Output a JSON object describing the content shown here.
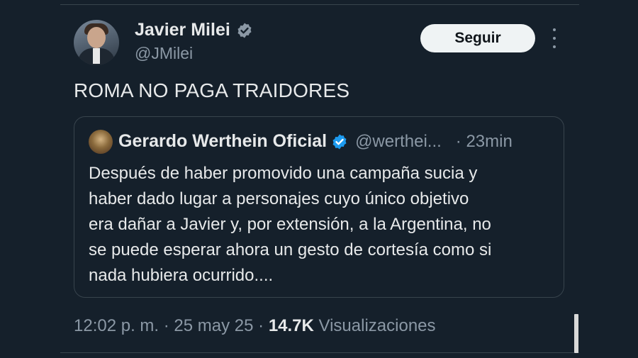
{
  "author": {
    "name": "Javier Milei",
    "handle": "@JMilei",
    "verified_color": "#8b98a5"
  },
  "follow_button": {
    "label": "Seguir"
  },
  "tweet": {
    "text": "ROMA NO PAGA TRAIDORES"
  },
  "quoted": {
    "name": "Gerardo Werthein Oficial",
    "handle": "@werthei...",
    "time": "· 23min",
    "verified_color": "#1d9bf0",
    "lines": [
      "Después de haber promovido una campaña sucia y",
      "haber dado lugar a personajes cuyo único objetivo",
      "era dañar a Javier y, por extensión, a la Argentina, no",
      "se puede esperar ahora un gesto de cortesía como si",
      "nada hubiera ocurrido...."
    ]
  },
  "meta": {
    "time": "12:02 p. m.",
    "sep1": " · ",
    "date": "25 may 25",
    "sep2": " · ",
    "views_count": "14.7K",
    "views_label": " Visualizaciones"
  },
  "colors": {
    "background": "#15202b",
    "text": "#e7e9ea",
    "secondary": "#8b98a5",
    "accent": "#1d9bf0"
  }
}
